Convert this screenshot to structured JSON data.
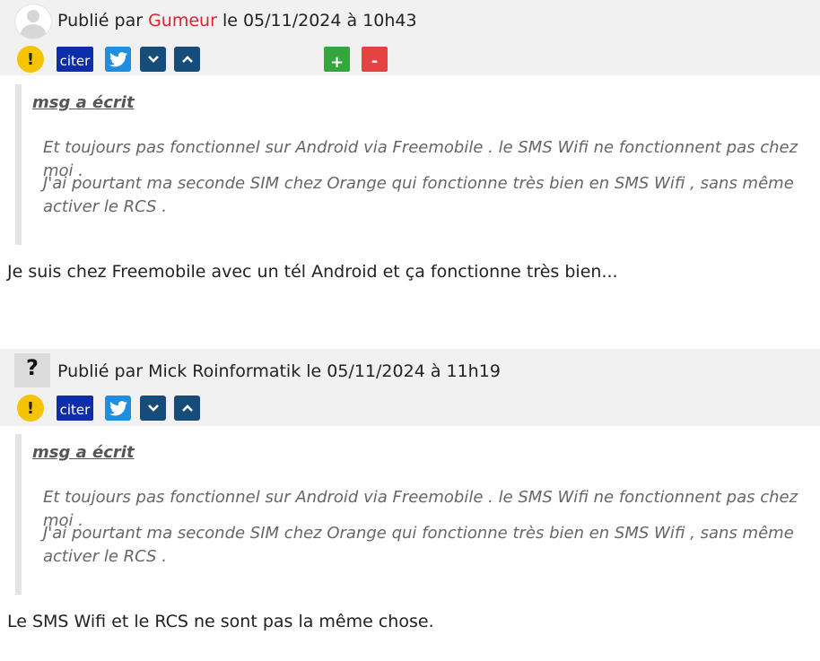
{
  "posts": [
    {
      "byline_prefix": "Publié par",
      "author": "Gumeur",
      "date": "le 05/11/2024 à 10h43",
      "alert_icon": "!",
      "cite_label": "citer",
      "plus_label": "+",
      "minus_label": "-",
      "quote": {
        "author": "msg a écrit",
        "line1": "Et toujours pas fonctionnel sur Android via Freemobile . le SMS Wifi ne fonctionnent pas chez moi .",
        "line2": "J'ai pourtant ma seconde SIM chez Orange qui fonctionne très bien en SMS Wifi , sans même activer le RCS ."
      },
      "reply": "Je suis chez Freemobile avec un tél Android et ça fonctionne très bien..."
    },
    {
      "byline_prefix": "Publié par",
      "author": "Mick Roinformatik",
      "date": "le 05/11/2024 à 11h19",
      "alert_icon": "!",
      "cite_label": "citer",
      "avatar_mark": "?",
      "quote": {
        "author": "msg a écrit",
        "line1": "Et toujours pas fonctionnel sur Android via Freemobile . le SMS Wifi ne fonctionnent pas chez moi .",
        "line2": "J'ai pourtant ma seconde SIM chez Orange qui fonctionne très bien en SMS Wifi , sans même activer le RCS ."
      },
      "reply": "Le SMS Wifi et le RCS ne sont pas la même chose."
    }
  ],
  "colors": {
    "author_highlight": "#d8242a",
    "cite_button": "#0d2ea8",
    "twitter_button": "#1d8ee0",
    "vote_arrow_button": "#154c7a",
    "plus_button": "#35a63c",
    "minus_button": "#e54242",
    "alert_button": "#f5c400"
  }
}
